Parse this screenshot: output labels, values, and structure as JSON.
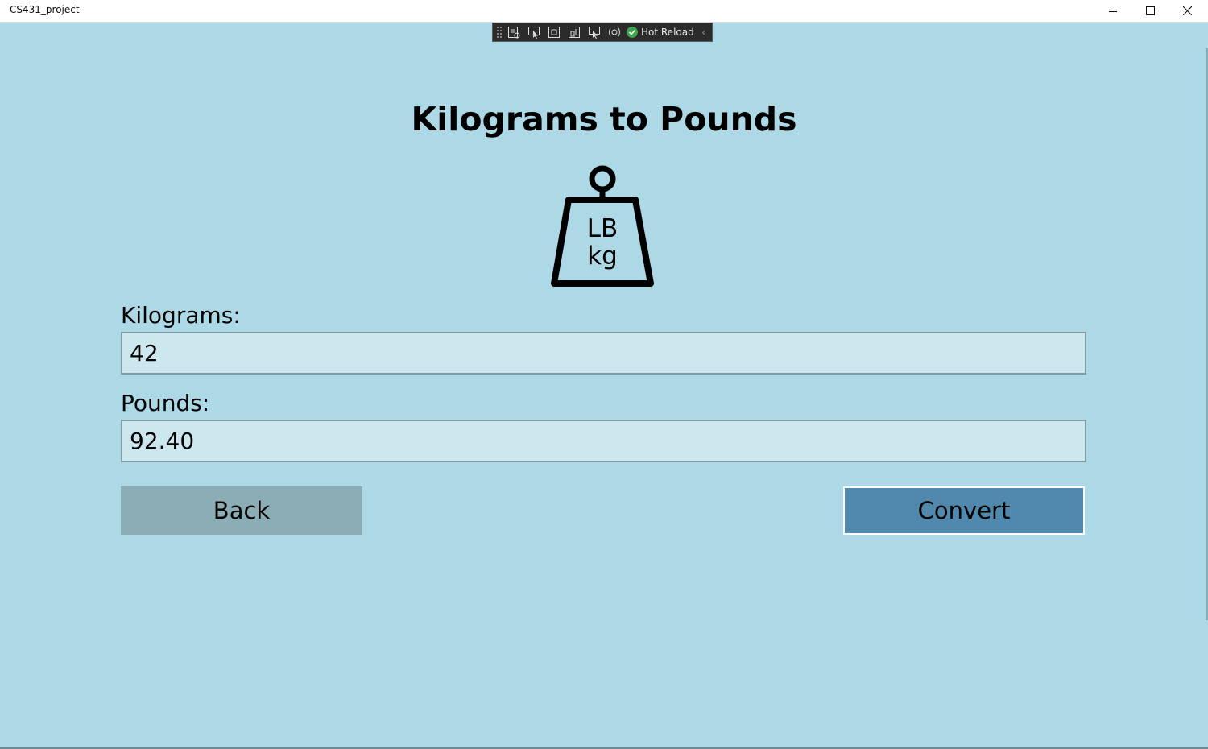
{
  "window": {
    "title": "CS431_project"
  },
  "devbar": {
    "hot_reload_label": "Hot Reload",
    "tools": [
      "live-visual-tree-icon",
      "select-element-icon",
      "display-adorners-icon",
      "track-focus-icon",
      "binding-failures-icon",
      "accessibility-checker-icon"
    ]
  },
  "page": {
    "heading": "Kilograms to Pounds",
    "icon_text_top": "LB",
    "icon_text_bottom": "kg"
  },
  "form": {
    "kilograms_label": "Kilograms:",
    "kilograms_value": "42",
    "pounds_label": "Pounds:",
    "pounds_value": "92.40"
  },
  "buttons": {
    "back_label": "Back",
    "convert_label": "Convert"
  },
  "colors": {
    "background": "#ADD8E6",
    "back_button": "#8BADB6",
    "convert_button": "#5089AD",
    "field_background": "#CDE7EF"
  }
}
